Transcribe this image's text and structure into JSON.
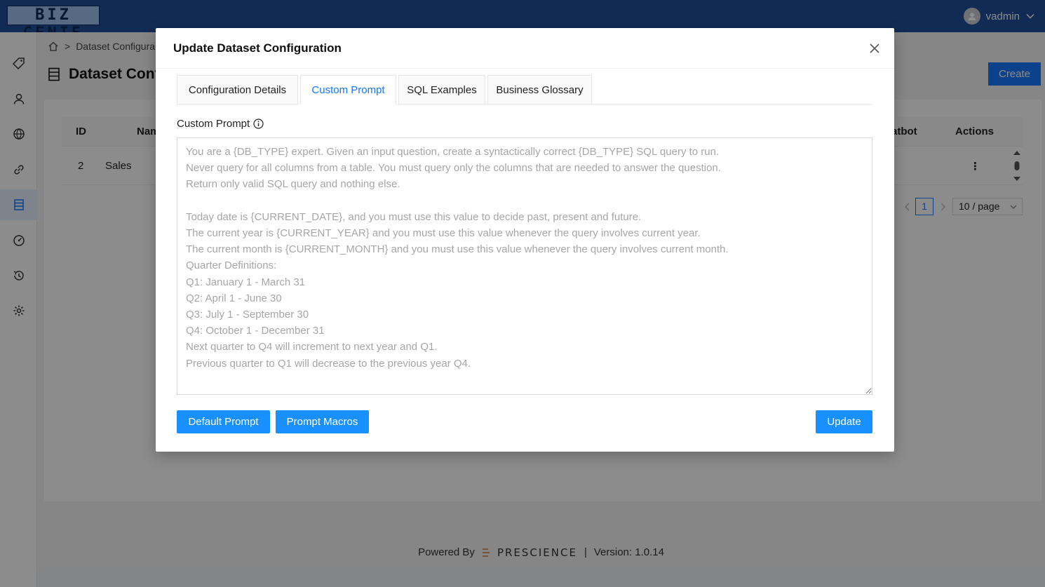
{
  "app": {
    "logo_text": "BIZ GENIE",
    "user_name": "vadmin"
  },
  "breadcrumb": {
    "current": "Dataset Configura"
  },
  "page": {
    "title": "Dataset Conf",
    "create_label": "Create"
  },
  "table": {
    "headers": {
      "id": "ID",
      "name": "Nam",
      "chatbot": "atbot",
      "actions": "Actions"
    },
    "rows": [
      {
        "id": "2",
        "name": "Sales",
        "actions": "⋮"
      }
    ]
  },
  "pagination": {
    "current_page": "1",
    "page_size": "10 / page"
  },
  "footer": {
    "powered_by": "Powered By",
    "brand": "PRESCIENCE",
    "separator": "|",
    "version": "Version: 1.0.14"
  },
  "modal": {
    "title": "Update Dataset Configuration",
    "tabs": [
      {
        "label": "Configuration Details"
      },
      {
        "label": "Custom Prompt"
      },
      {
        "label": "SQL Examples"
      },
      {
        "label": "Business Glossary"
      }
    ],
    "active_tab": "Custom Prompt",
    "field_label": "Custom Prompt",
    "prompt_text": "You are a {DB_TYPE} expert. Given an input question, create a syntactically correct {DB_TYPE} SQL query to run.\nNever query for all columns from a table. You must query only the columns that are needed to answer the question.\nReturn only valid SQL query and nothing else.\n\nToday date is {CURRENT_DATE}, and you must use this value to decide past, present and future.\nThe current year is {CURRENT_YEAR} and you must use this value whenever the query involves current year.\nThe current month is {CURRENT_MONTH} and you must use this value whenever the query involves current month.\nQuarter Definitions:\nQ1: January 1 - March 31\nQ2: April 1 - June 30\nQ3: July 1 - September 30\nQ4: October 1 - December 31\nNext quarter to Q4 will increment to next year and Q1.\nPrevious quarter to Q1 will decrease to the previous year Q4.",
    "buttons": {
      "default_prompt": "Default Prompt",
      "prompt_macros": "Prompt Macros",
      "update": "Update"
    }
  },
  "colors": {
    "topbar": "#1f4f9a",
    "primary": "#1890ff",
    "active_tab": "#1677ff"
  },
  "icons": {
    "sidebar": [
      "tag-icon",
      "user-icon",
      "globe-icon",
      "link-icon",
      "dataset-icon",
      "dashboard-icon",
      "history-icon",
      "settings-icon"
    ]
  }
}
